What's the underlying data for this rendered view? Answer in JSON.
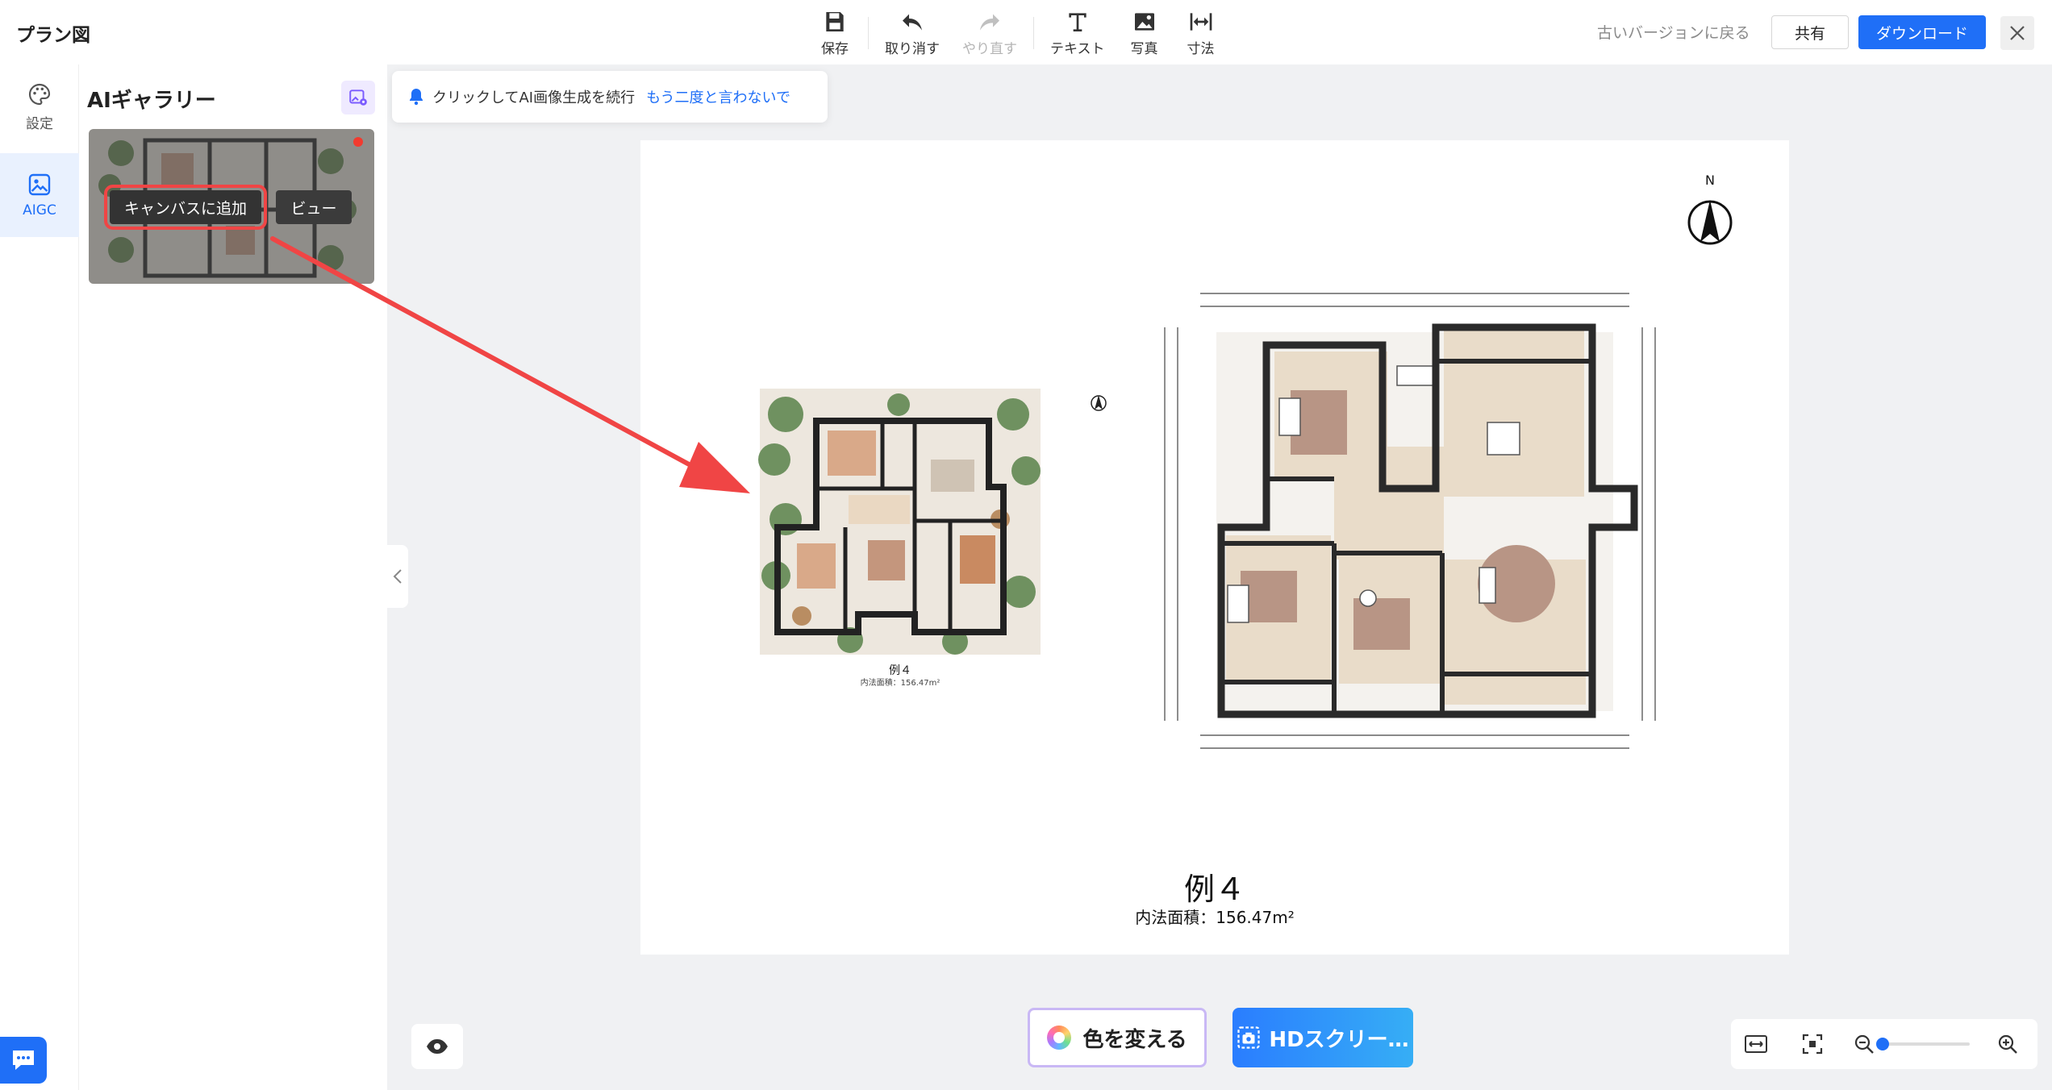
{
  "app": {
    "title": "プラン図"
  },
  "toolbar": {
    "save": "保存",
    "undo": "取り消す",
    "redo": "やり直す",
    "text": "テキスト",
    "photo": "写真",
    "dimension": "寸法",
    "old_version": "古いバージョンに戻る",
    "share": "共有",
    "download": "ダウンロード"
  },
  "rail": {
    "settings": "設定",
    "aigc": "AIGC"
  },
  "panel": {
    "title": "AIギャラリー",
    "add_to_canvas": "キャンバスに追加",
    "view": "ビュー"
  },
  "notice": {
    "text": "クリックしてAI画像生成を続行",
    "link": "もう二度と言わないで"
  },
  "canvas": {
    "north_label": "N",
    "plan_title": "例４",
    "plan_area": "内法面積：156.47m²",
    "small_plan_title": "例４",
    "small_plan_area": "内法面積：156.47m²"
  },
  "bottom": {
    "change_color": "色を変える",
    "hd_screen": "HDスクリー…"
  },
  "colors": {
    "accent": "#1f6ff7",
    "highlight": "#f04545",
    "wall": "#2b2b2b",
    "floor": "#e9dcc9",
    "rug": "#b89585"
  }
}
